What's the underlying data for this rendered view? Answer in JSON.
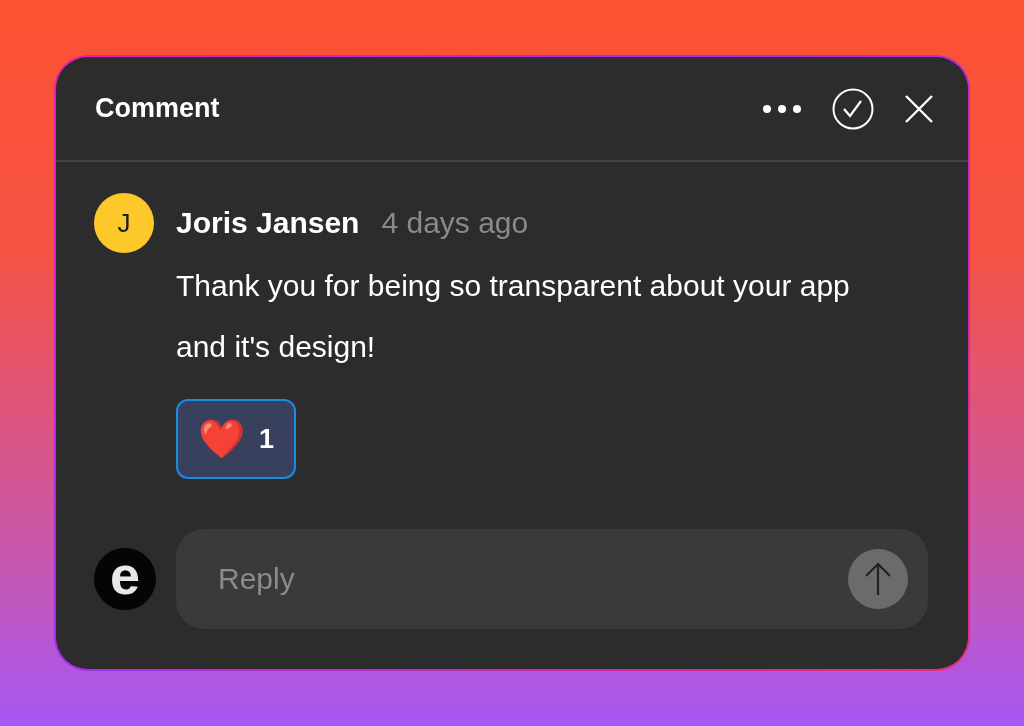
{
  "header": {
    "title": "Comment"
  },
  "comment": {
    "avatar_letter": "J",
    "author": "Joris Jansen",
    "time": "4 days ago",
    "text": "Thank you for being so transparent about your app and it's design!",
    "reactions": [
      {
        "emoji": "❤️",
        "count": "1",
        "selected": true
      }
    ]
  },
  "reply": {
    "avatar_letter": "e",
    "placeholder": "Reply"
  }
}
